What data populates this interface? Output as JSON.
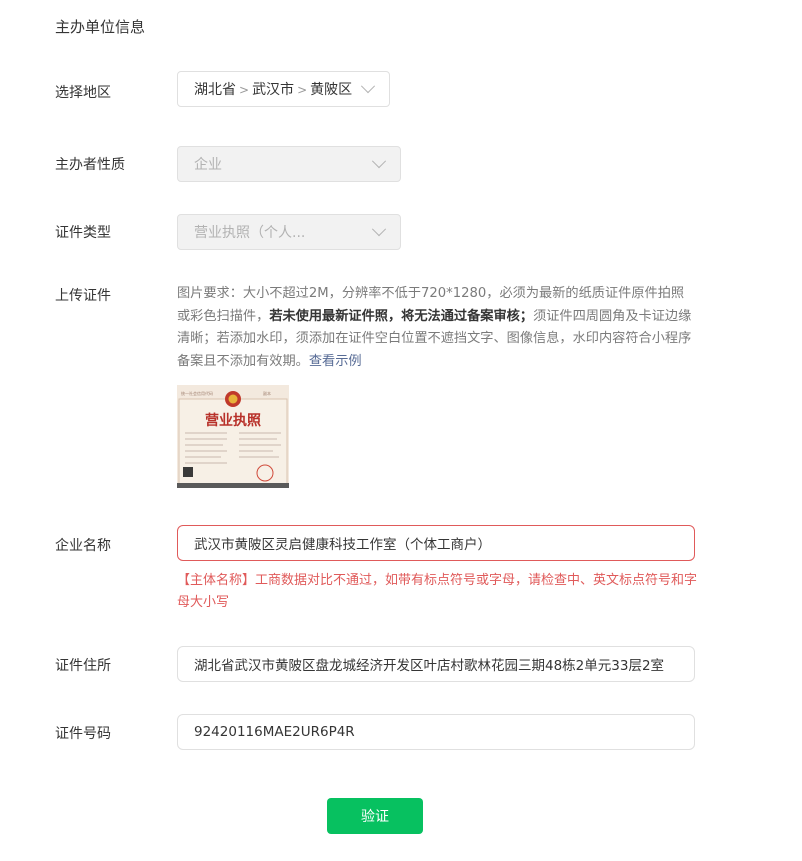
{
  "section_title": "主办单位信息",
  "region": {
    "label": "选择地区",
    "province": "湖北省",
    "city": "武汉市",
    "district": "黄陂区",
    "separator": ">"
  },
  "nature": {
    "label": "主办者性质",
    "value": "企业"
  },
  "cert_type": {
    "label": "证件类型",
    "value": "营业执照（个人..."
  },
  "upload": {
    "label": "上传证件",
    "desc_part1": "图片要求：大小不超过2M，分辨率不低于720*1280，必须为最新的纸质证件原件拍照或彩色扫描件，",
    "desc_bold": "若未使用最新证件照，将无法通过备案审核；",
    "desc_part2": "须证件四周圆角及卡证边缘清晰；若添加水印，须添加在证件空白位置不遮挡文字、图像信息，水印内容符合小程序备案且不添加有效期。",
    "example_link": "查看示例",
    "license_title": "营业执照"
  },
  "company": {
    "label": "企业名称",
    "value": "武汉市黄陂区灵启健康科技工作室（个体工商户）",
    "error": "【主体名称】工商数据对比不通过，如带有标点符号或字母，请检查中、英文标点符号和字母大小写"
  },
  "address": {
    "label": "证件住所",
    "value": "湖北省武汉市黄陂区盘龙城经济开发区叶店村歌林花园三期48栋2单元33层2室"
  },
  "cert_no": {
    "label": "证件号码",
    "value": "92420116MAE2UR6P4R"
  },
  "verify_button": "验证",
  "colors": {
    "primary": "#07c160",
    "error": "#e05a5a",
    "link": "#576b95"
  }
}
